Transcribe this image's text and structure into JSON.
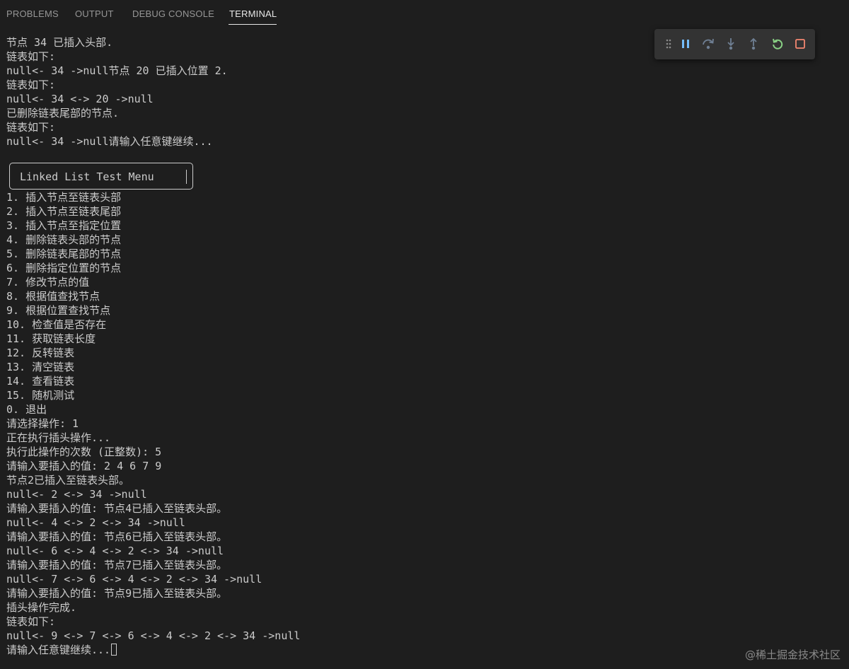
{
  "panel": {
    "tabs": [
      {
        "label": "PROBLEMS"
      },
      {
        "label": "OUTPUT"
      },
      {
        "label": "DEBUG CONSOLE"
      },
      {
        "label": "TERMINAL"
      }
    ],
    "active_tab": "TERMINAL"
  },
  "debug_toolbar": {
    "icons": [
      "grip-icon",
      "pause-icon",
      "step-over-icon",
      "step-into-icon",
      "step-out-icon",
      "restart-icon",
      "stop-icon"
    ],
    "colors": {
      "pause": "#75beff",
      "disabled": "#6f7f93",
      "restart": "#89d185",
      "stop": "#f48771",
      "grip": "#8b8b8b"
    }
  },
  "terminal": {
    "lines_top": [
      "节点 34 已插入头部.",
      "链表如下:",
      "null<- 34 ->null节点 20 已插入位置 2.",
      "链表如下:",
      "null<- 34 <-> 20 ->null",
      "已删除链表尾部的节点.",
      "链表如下:",
      "null<- 34 ->null请输入任意键继续...",
      ""
    ],
    "menu_title": "Linked List Test Menu",
    "lines_bottom": [
      "1. 插入节点至链表头部",
      "2. 插入节点至链表尾部",
      "3. 插入节点至指定位置",
      "4. 删除链表头部的节点",
      "5. 删除链表尾部的节点",
      "6. 删除指定位置的节点",
      "7. 修改节点的值",
      "8. 根据值查找节点",
      "9. 根据位置查找节点",
      "10. 检查值是否存在",
      "11. 获取链表长度",
      "12. 反转链表",
      "13. 清空链表",
      "14. 查看链表",
      "15. 随机测试",
      "0. 退出",
      "请选择操作: 1",
      "正在执行插头操作...",
      "执行此操作的次数 (正整数): 5",
      "请输入要插入的值: 2 4 6 7 9",
      "节点2已插入至链表头部。",
      "null<- 2 <-> 34 ->null",
      "请输入要插入的值: 节点4已插入至链表头部。",
      "null<- 4 <-> 2 <-> 34 ->null",
      "请输入要插入的值: 节点6已插入至链表头部。",
      "null<- 6 <-> 4 <-> 2 <-> 34 ->null",
      "请输入要插入的值: 节点7已插入至链表头部。",
      "null<- 7 <-> 6 <-> 4 <-> 2 <-> 34 ->null",
      "请输入要插入的值: 节点9已插入至链表头部。",
      "插头操作完成.",
      "链表如下:",
      "null<- 9 <-> 7 <-> 6 <-> 4 <-> 2 <-> 34 ->null"
    ],
    "prompt_line": "请输入任意键继续..."
  },
  "watermark": "@稀土掘金技术社区"
}
